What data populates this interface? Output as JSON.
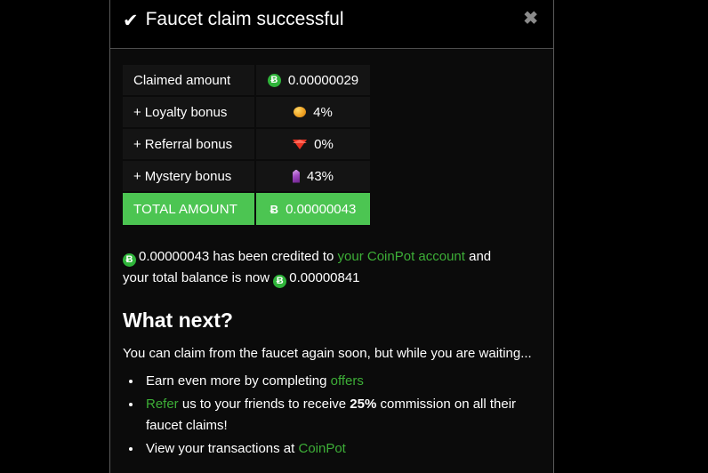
{
  "modal": {
    "header": {
      "check_icon": "check-icon",
      "title": "Faucet claim successful",
      "close_label": "✖"
    },
    "table": {
      "rows": [
        {
          "label": "Claimed amount",
          "prefix": "",
          "icon": "bitcoin-badge-icon",
          "value": "0.00000029"
        },
        {
          "label": "Loyalty bonus",
          "prefix": "+",
          "icon": "coin-icon",
          "value": "4%"
        },
        {
          "label": "Referral bonus",
          "prefix": "+",
          "icon": "red-gem-icon",
          "value": "0%"
        },
        {
          "label": "Mystery bonus",
          "prefix": "+",
          "icon": "purple-crystal-icon",
          "value": "43%"
        }
      ],
      "total": {
        "label": "TOTAL AMOUNT",
        "icon": "bitcoin-symbol-icon",
        "symbol": "Ƀ",
        "value": "0.00000043"
      }
    },
    "credit": {
      "amount": "0.00000043",
      "text_1": "has been credited to",
      "account_link": "your CoinPot account",
      "text_2": "and your total balance is now",
      "balance": "0.00000841"
    },
    "what_next": {
      "heading": "What next?",
      "subtitle": "You can claim from the faucet again soon, but while you are waiting...",
      "items": [
        {
          "text_1": "Earn even more by completing",
          "link": "offers",
          "text_2": ""
        },
        {
          "link": "Refer",
          "text_1": "us to your friends to receive",
          "emphasis": "25%",
          "text_2": "commission on all their faucet claims!"
        },
        {
          "text_1": "View your transactions at",
          "link": "CoinPot",
          "text_2": ""
        }
      ]
    }
  },
  "colors": {
    "accent_green": "#3dae37",
    "total_green": "#4cc552",
    "background": "#000000",
    "modal_background": "#0b0b0b",
    "cell_background": "#141414"
  }
}
